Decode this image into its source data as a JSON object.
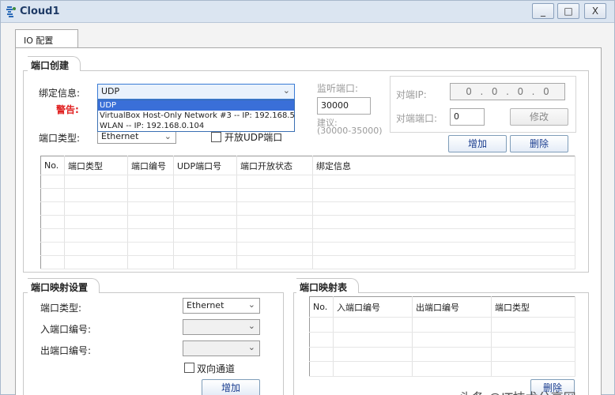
{
  "window": {
    "title": "Cloud1",
    "minimize": "_",
    "maximize": "□",
    "close": "X"
  },
  "tab": {
    "label": "IO 配置"
  },
  "port_create": {
    "title": "端口创建",
    "bind_label": "绑定信息:",
    "bind_value": "UDP",
    "warn_label": "警告:",
    "dropdown_options": [
      "UDP",
      "VirtualBox Host-Only Network #3 -- IP: 192.168.56.1",
      "WLAN -- IP: 192.168.0.104"
    ],
    "port_type_label": "端口类型:",
    "port_type_value": "Ethernet",
    "open_udp_label": "开放UDP端口",
    "listen_label": "监听端口:",
    "listen_value": "30000",
    "suggest_label": "建议:",
    "suggest_range": "(30000-35000)",
    "peer_ip_label": "对端IP:",
    "peer_ip": [
      "0",
      "0",
      "0",
      "0"
    ],
    "peer_port_label": "对端端口:",
    "peer_port_value": "0",
    "modify_button": "修改",
    "add_button": "增加",
    "delete_button": "删除",
    "table_headers": [
      "No.",
      "端口类型",
      "端口编号",
      "UDP端口号",
      "端口开放状态",
      "绑定信息"
    ]
  },
  "port_map": {
    "title": "端口映射设置",
    "type_label": "端口类型:",
    "type_value": "Ethernet",
    "in_label": "入端口编号:",
    "out_label": "出端口编号:",
    "bidir_label": "双向通道",
    "add_button": "增加"
  },
  "map_table": {
    "title": "端口映射表",
    "headers": [
      "No.",
      "入端口编号",
      "出端口编号",
      "端口类型"
    ],
    "delete_button": "删除"
  },
  "watermark": "头条 @IT技术分享网"
}
